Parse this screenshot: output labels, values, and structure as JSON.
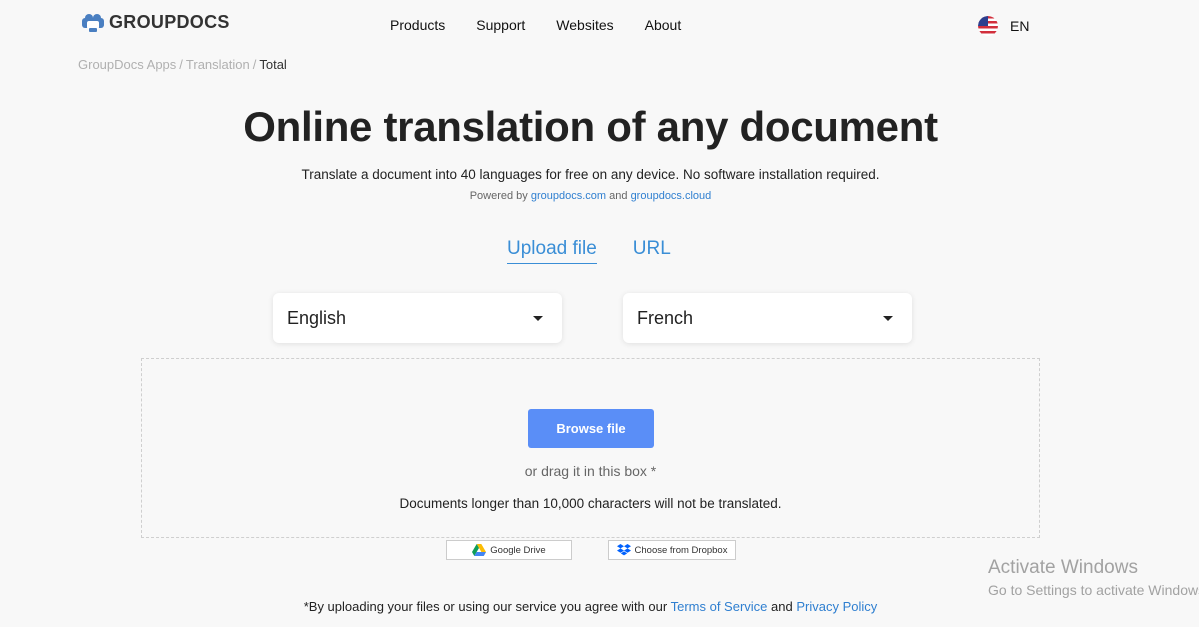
{
  "header": {
    "logo_text": "GROUPDOCS",
    "nav": [
      "Products",
      "Support",
      "Websites",
      "About"
    ],
    "language": "EN"
  },
  "breadcrumb": {
    "items": [
      "GroupDocs Apps",
      "Translation"
    ],
    "current": "Total",
    "separator": "/"
  },
  "hero": {
    "title": "Online translation of any document",
    "subtitle": "Translate a document into 40 languages for free on any device. No software installation required.",
    "powered_prefix": "Powered by",
    "powered_link1": "groupdocs.com",
    "powered_and": "and",
    "powered_link2": "groupdocs.cloud"
  },
  "tabs": {
    "upload": "Upload file",
    "url": "URL"
  },
  "languages": {
    "source": "English",
    "target": "French"
  },
  "dropzone": {
    "browse_label": "Browse file",
    "drag_hint": "or drag it in this box *",
    "limit_note": "Documents longer than 10,000 characters will not be translated."
  },
  "cloud": {
    "gdrive_label": "Google Drive",
    "dropbox_label": "Choose from Dropbox"
  },
  "terms": {
    "prefix": "*By uploading your files or using our service you agree with our",
    "tos": "Terms of Service",
    "and": "and",
    "privacy": "Privacy Policy"
  },
  "watermark": {
    "title": "Activate Windows",
    "subtitle": "Go to Settings to activate Windows."
  },
  "colors": {
    "accent": "#3a8ed6",
    "browse_button": "#5a8ef7",
    "background": "#f8f8f8"
  },
  "icons": [
    "groupdocs-logo-icon",
    "us-flag-icon",
    "caret-down-icon",
    "google-drive-icon",
    "dropbox-icon"
  ]
}
